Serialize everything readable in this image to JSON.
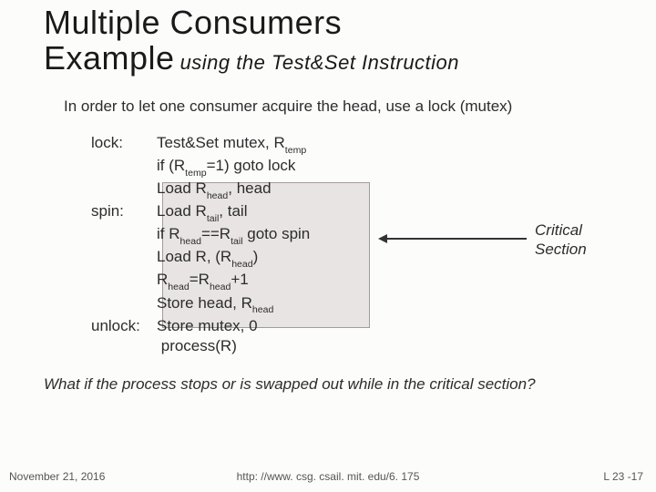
{
  "title": {
    "line1": "Multiple Consumers",
    "line2_main": "Example",
    "line2_sub": "using the Test&Set Instruction"
  },
  "intro": "In order to let one consumer acquire the head, use a lock (mutex)",
  "labels": {
    "lock": "lock:",
    "spin": "spin:",
    "unlock": "unlock:"
  },
  "code": {
    "l1a": "Test&Set mutex, R",
    "l1b": "temp",
    "l2a": "if (R",
    "l2b": "temp",
    "l2c": "=1) goto lock",
    "l3a": "Load R",
    "l3b": "head",
    "l3c": ", head",
    "l4a": "Load R",
    "l4b": "tail",
    "l4c": ", tail",
    "l5a": "if R",
    "l5b": "head",
    "l5c": "==R",
    "l5d": "tail",
    "l5e": " goto spin",
    "l6a": "Load R, (R",
    "l6b": "head",
    "l6c": ")",
    "l7a": "R",
    "l7b": "head",
    "l7c": "=R",
    "l7d": "head",
    "l7e": "+1",
    "l8a": "Store head, R",
    "l8b": "head",
    "l9": "Store mutex, 0",
    "l10": "process(R)"
  },
  "crit": {
    "line1": "Critical",
    "line2": "Section"
  },
  "question": "What if the process stops or is swapped out while in the critical section?",
  "footer": {
    "date": "November 21, 2016",
    "url": "http: //www. csg. csail. mit. edu/6. 175",
    "page": "L 23 -17"
  }
}
